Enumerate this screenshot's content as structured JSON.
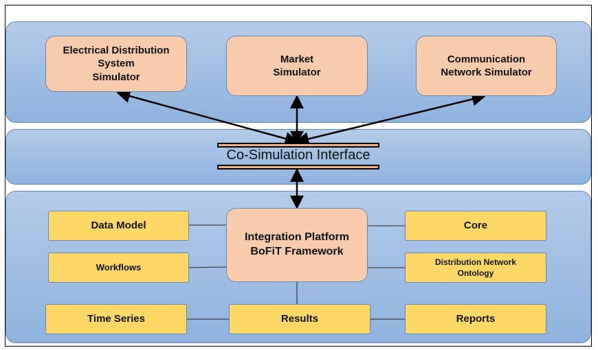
{
  "top": {
    "electrical": "Electrical Distribution\nSystem\nSimulator",
    "market": "Market\nSimulator",
    "communication": "Communication\nNetwork Simulator"
  },
  "interface": {
    "label": "Co-Simulation Interface"
  },
  "bottom": {
    "platform": "Integration Platform\nBoFiT Framework",
    "data_model": "Data Model",
    "workflows": "Workflows",
    "core": "Core",
    "ontology": "Distribution Network\nOntology",
    "time_series": "Time Series",
    "results": "Results",
    "reports": "Reports"
  },
  "colors": {
    "simulator": "#f7cbac",
    "module": "#fdd866",
    "panel": "#a3c0e4"
  }
}
